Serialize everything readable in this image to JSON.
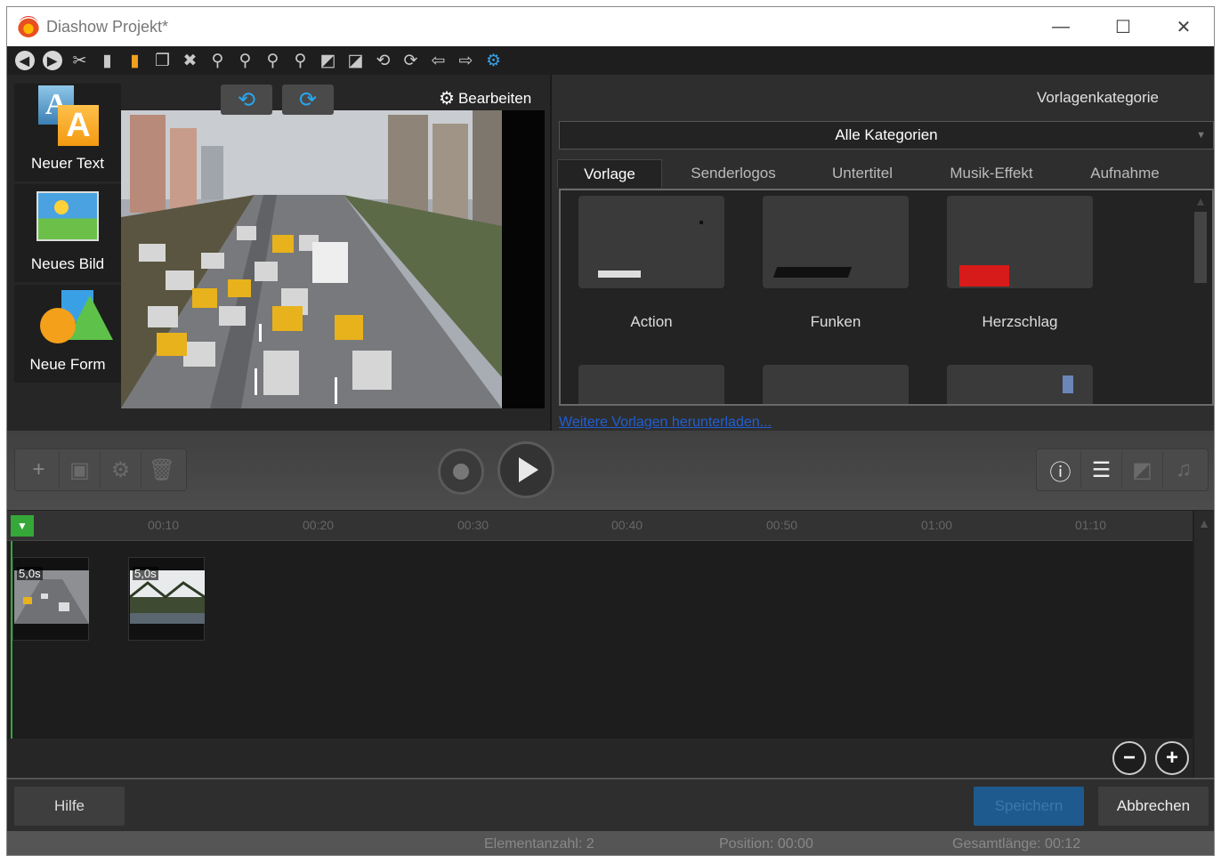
{
  "window": {
    "title": "Diashow Projekt*",
    "minimize": "—",
    "maximize": "☐",
    "close": "✕"
  },
  "toolbar": {
    "icons": [
      "back-icon",
      "forward-icon",
      "cut-icon",
      "paste-icon",
      "paste-special-icon",
      "copy-icon",
      "delete-icon",
      "zoom-in-icon",
      "zoom-out-icon",
      "zoom-fit-icon",
      "zoom-reset-icon",
      "flip-icon",
      "mirror-icon",
      "rotate-left-icon",
      "rotate-right-icon",
      "move-left-icon",
      "move-right-icon",
      "settings-icon"
    ]
  },
  "left": {
    "new_text": "Neuer Text",
    "new_image": "Neues Bild",
    "new_shape": "Neue Form",
    "edit": "Bearbeiten"
  },
  "right": {
    "category_label": "Vorlagenkategorie",
    "category_value": "Alle Kategorien",
    "tabs": [
      "Vorlage",
      "Senderlogos",
      "Untertitel",
      "Musik-Effekt",
      "Aufnahme"
    ],
    "templates": [
      "Action",
      "Funken",
      "Herzschlag"
    ],
    "link": "Weitere Vorlagen herunterladen..."
  },
  "timeline": {
    "ticks": [
      "00:10",
      "00:20",
      "00:30",
      "00:40",
      "00:50",
      "01:00",
      "01:10"
    ],
    "clips": [
      "5,0s",
      "5,0s"
    ]
  },
  "footer": {
    "help": "Hilfe",
    "save": "Speichern",
    "cancel": "Abbrechen"
  },
  "status": {
    "count": "Elementanzahl: 2",
    "position": "Position: 00:00",
    "length": "Gesamtlänge: 00:12"
  }
}
